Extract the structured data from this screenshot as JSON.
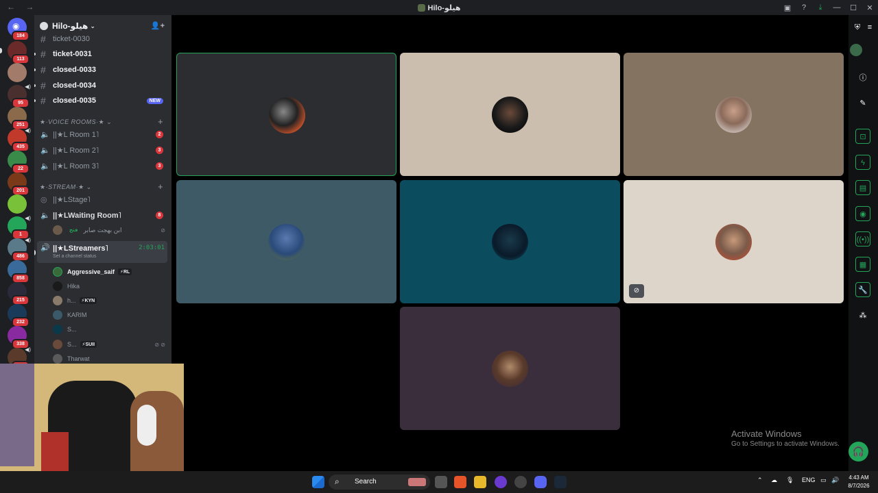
{
  "window": {
    "title": "Hilo-هيلو",
    "nav_glyphs": "← →"
  },
  "server_rail": [
    {
      "badge": "184"
    },
    {
      "badge": "113"
    },
    {
      "badge": ""
    },
    {
      "badge": "95"
    },
    {
      "badge": "251"
    },
    {
      "badge": "435"
    },
    {
      "badge": "22"
    },
    {
      "badge": "201"
    },
    {
      "badge": ""
    },
    {
      "badge": "1"
    },
    {
      "badge": "486"
    },
    {
      "badge": "858"
    },
    {
      "badge": "215"
    },
    {
      "badge": "232"
    },
    {
      "badge": "338"
    },
    {
      "badge": "4K+"
    }
  ],
  "sidebar": {
    "server_name": "Hilo-هيلو",
    "channels": [
      {
        "name": "ticket-0030"
      },
      {
        "name": "ticket-0031"
      },
      {
        "name": "closed-0033"
      },
      {
        "name": "closed-0034"
      },
      {
        "name": "closed-0035",
        "badge": "NEW"
      }
    ],
    "voice_category": "★·VOICE ROOMS·★",
    "voice_rooms": [
      {
        "name": "||★L Room 1˥",
        "count": "2"
      },
      {
        "name": "||★L Room 2˥",
        "count": "3"
      },
      {
        "name": "||★L Room 3˥",
        "count": "3"
      }
    ],
    "stream_category": "★·STREAM·★",
    "stage_name": "||★LStage˥",
    "waiting_room": {
      "name": "||★LWaiting Room˥",
      "count": "8"
    },
    "waiting_user": {
      "name": "ابن بهجت صابر",
      "tag": "فتح"
    },
    "active_channel": {
      "name": "||★LStreamers˥",
      "timer": "2:03:01",
      "status": "Set a channel status"
    },
    "members": [
      {
        "name": "Aggressive_saif",
        "tag": "RL"
      },
      {
        "name": "Hika",
        "tag": ""
      },
      {
        "name": "h...",
        "tag": "KYN"
      },
      {
        "name": "KARIM",
        "tag": ""
      },
      {
        "name": "S...",
        "tag": ""
      },
      {
        "name": "S...",
        "tag": "SUII"
      },
      {
        "name": "Tharwat",
        "tag": ""
      }
    ]
  },
  "watermark": {
    "line1": "Activate Windows",
    "line2": "Go to Settings to activate Windows."
  },
  "taskbar": {
    "search_label": "Search",
    "lang": "ENG",
    "time": "4:43 AM",
    "date": "8/7/2026"
  },
  "icons": {
    "titlebar": [
      "inbox-icon",
      "help-icon",
      "download-icon",
      "minimize-icon",
      "maximize-icon",
      "close-icon"
    ],
    "toolbar": [
      "shield-icon",
      "menu-icon",
      "info-icon",
      "pencil-icon",
      "focus-icon",
      "bolt-icon",
      "document-icon",
      "chat-icon",
      "broadcast-icon",
      "layout-icon",
      "wrench-icon",
      "apps-icon"
    ]
  },
  "colors": {
    "accent_green": "#23a55a",
    "badge_red": "#da373c",
    "brand": "#5865f2"
  }
}
